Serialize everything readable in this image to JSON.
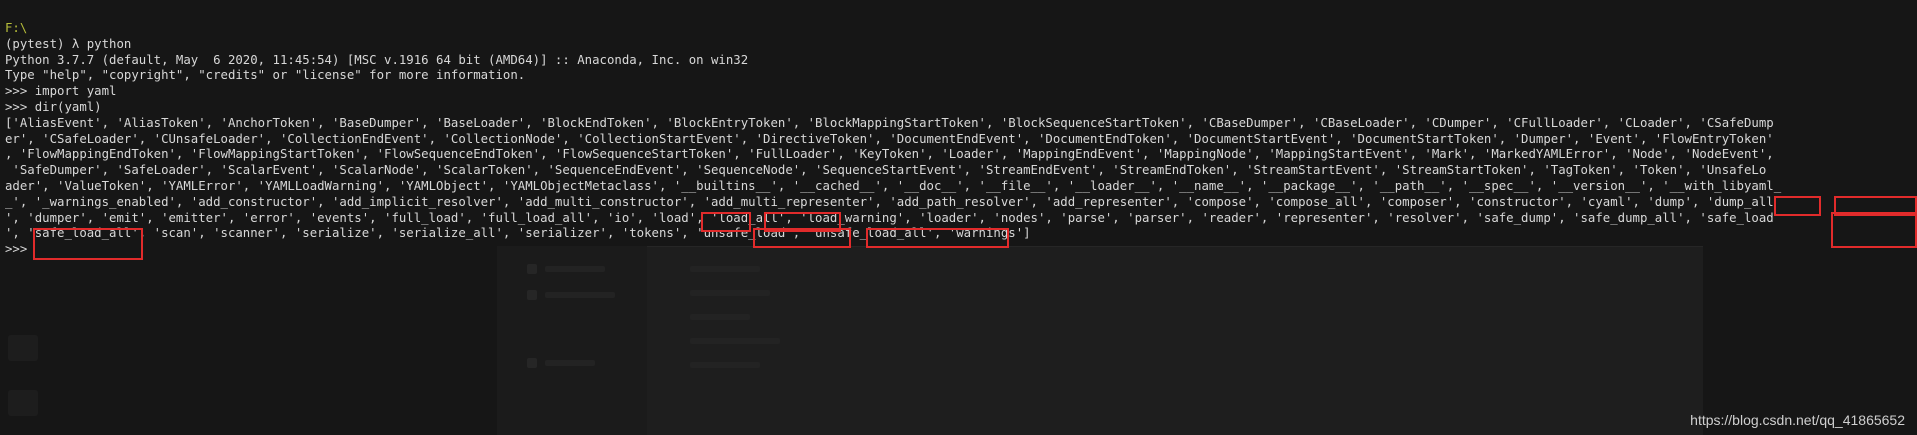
{
  "terminal": {
    "path": "F:\\",
    "lines": [
      "(pytest) λ python",
      "Python 3.7.7 (default, May  6 2020, 11:45:54) [MSC v.1916 64 bit (AMD64)] :: Anaconda, Inc. on win32",
      "Type \"help\", \"copyright\", \"credits\" or \"license\" for more information.",
      ">>> import yaml",
      ">>> dir(yaml)",
      "['AliasEvent', 'AliasToken', 'AnchorToken', 'BaseDumper', 'BaseLoader', 'BlockEndToken', 'BlockEntryToken', 'BlockMappingStartToken', 'BlockSequenceStartToken', 'CBaseDumper', 'CBaseLoader', 'CDumper', 'CFullLoader', 'CLoader', 'CSafeDump",
      "er', 'CSafeLoader', 'CUnsafeLoader', 'CollectionEndEvent', 'CollectionNode', 'CollectionStartEvent', 'DirectiveToken', 'DocumentEndEvent', 'DocumentEndToken', 'DocumentStartEvent', 'DocumentStartToken', 'Dumper', 'Event', 'FlowEntryToken'",
      ", 'FlowMappingEndToken', 'FlowMappingStartToken', 'FlowSequenceEndToken', 'FlowSequenceStartToken', 'FullLoader', 'KeyToken', 'Loader', 'MappingEndEvent', 'MappingNode', 'MappingStartEvent', 'Mark', 'MarkedYAMLError', 'Node', 'NodeEvent',",
      " 'SafeDumper', 'SafeLoader', 'ScalarEvent', 'ScalarNode', 'ScalarToken', 'SequenceEndEvent', 'SequenceNode', 'SequenceStartEvent', 'StreamEndEvent', 'StreamEndToken', 'StreamStartEvent', 'StreamStartToken', 'TagToken', 'Token', 'UnsafeLo",
      "ader', 'ValueToken', 'YAMLError', 'YAMLLoadWarning', 'YAMLObject', 'YAMLObjectMetaclass', '__builtins__', '__cached__', '__doc__', '__file__', '__loader__', '__name__', '__package__', '__path__', '__spec__', '__version__', '__with_libyaml_",
      "_', '_warnings_enabled', 'add_constructor', 'add_implicit_resolver', 'add_multi_constructor', 'add_multi_representer', 'add_path_resolver', 'add_representer', 'compose', 'compose_all', 'composer', 'constructor', 'cyaml', 'dump', 'dump_all",
      "', 'dumper', 'emit', 'emitter', 'error', 'events', 'full_load', 'full_load_all', 'io', 'load', 'load_all', 'load_warning', 'loader', 'nodes', 'parse', 'parser', 'reader', 'representer', 'resolver', 'safe_dump', 'safe_dump_all', 'safe_load",
      "', 'safe_load_all', 'scan', 'scanner', 'serialize', 'serialize_all', 'serializer', 'tokens', 'unsafe_load', 'unsafe_load_all', 'warnings']",
      ">>>"
    ]
  },
  "watermark": "https://blog.csdn.net/qq_41865652",
  "colors": {
    "background": "#161616",
    "text": "#d8d8d8",
    "prompt_path": "#b6bd3a",
    "highlight_box": "#e12b2b"
  }
}
